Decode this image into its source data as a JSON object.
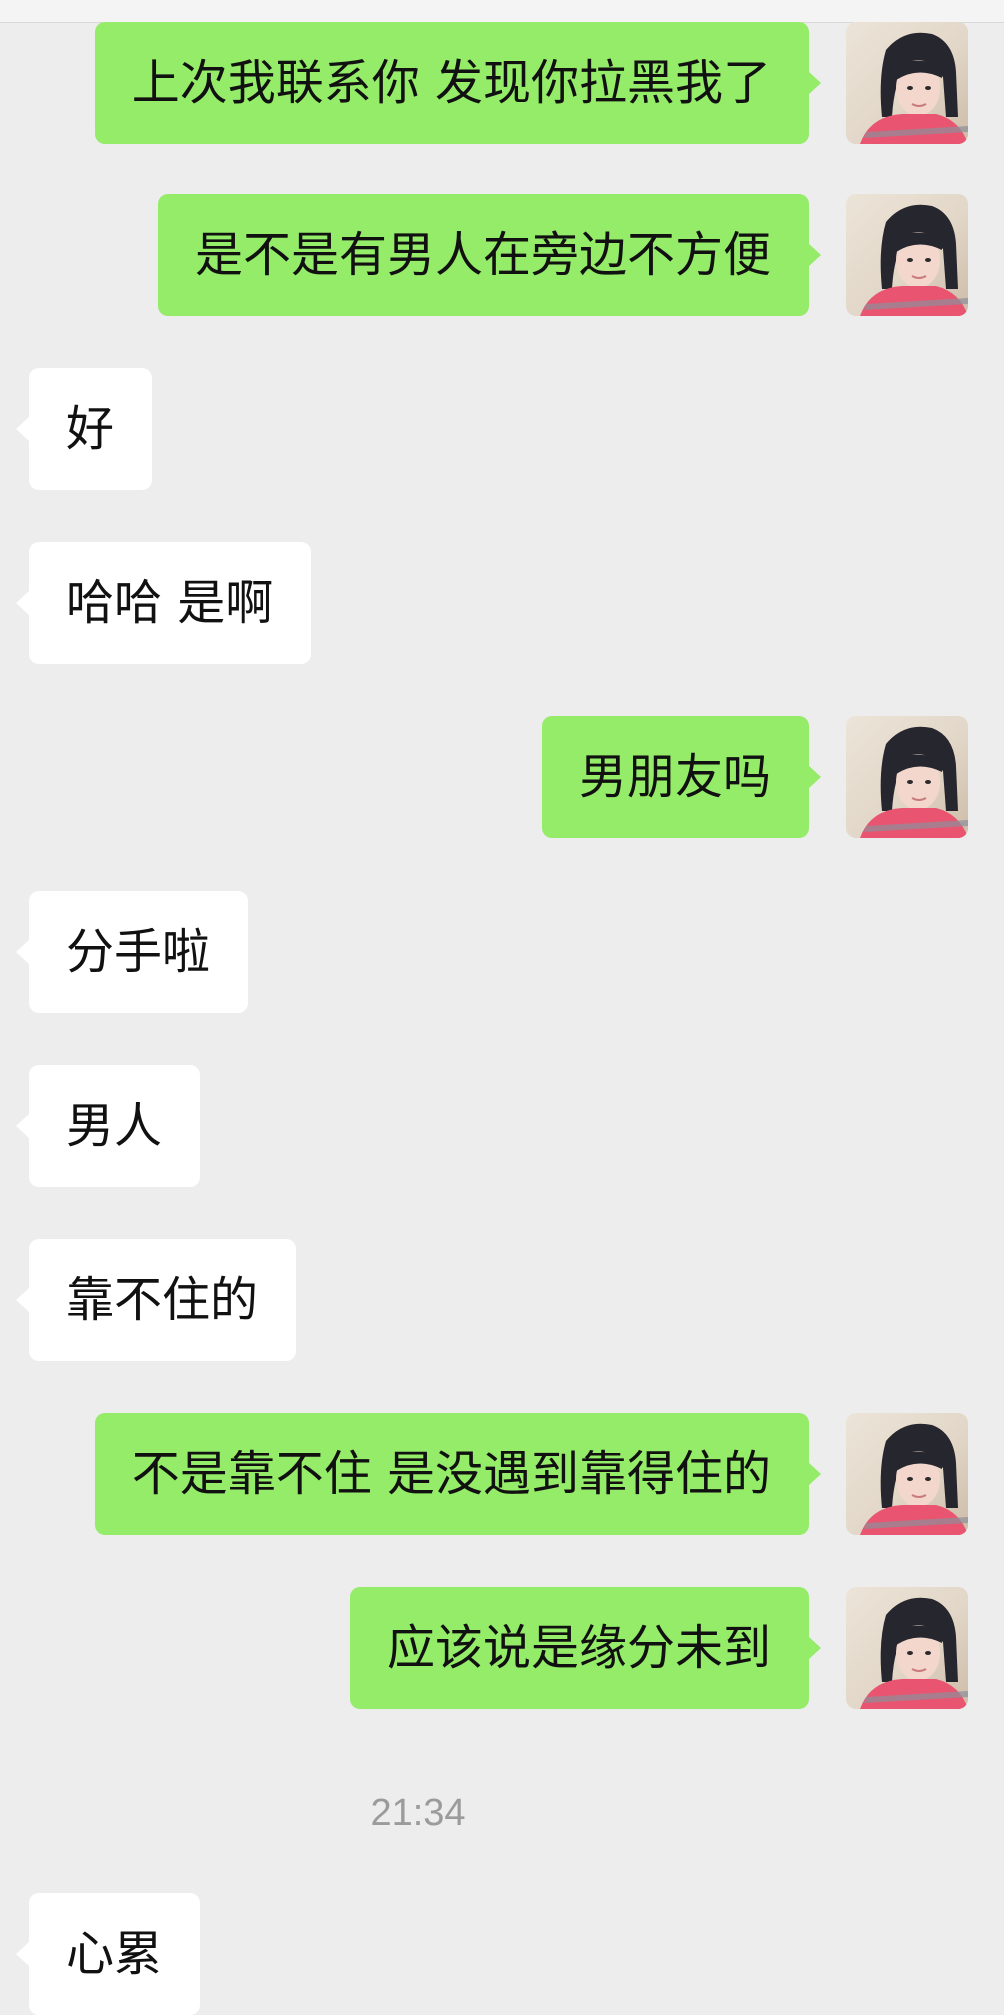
{
  "messages": [
    {
      "side": "out",
      "text": "上次我联系你 发现你拉黑我了"
    },
    {
      "side": "out",
      "text": "是不是有男人在旁边不方便"
    },
    {
      "side": "in",
      "text": "好"
    },
    {
      "side": "in",
      "text": "哈哈 是啊"
    },
    {
      "side": "out",
      "text": "男朋友吗"
    },
    {
      "side": "in",
      "text": "分手啦"
    },
    {
      "side": "in",
      "text": "男人"
    },
    {
      "side": "in",
      "text": "靠不住的"
    },
    {
      "side": "out",
      "text": "不是靠不住  是没遇到靠得住的"
    },
    {
      "side": "out",
      "text": "应该说是缘分未到"
    },
    {
      "side": "in",
      "text": "心累"
    }
  ],
  "timestamp": "21:34",
  "colors": {
    "background": "#ededed",
    "outgoing_bubble": "#95ec69",
    "incoming_bubble": "#ffffff",
    "timestamp_text": "#9b9b9b"
  },
  "icons": {
    "avatar": "user-avatar-photo"
  }
}
